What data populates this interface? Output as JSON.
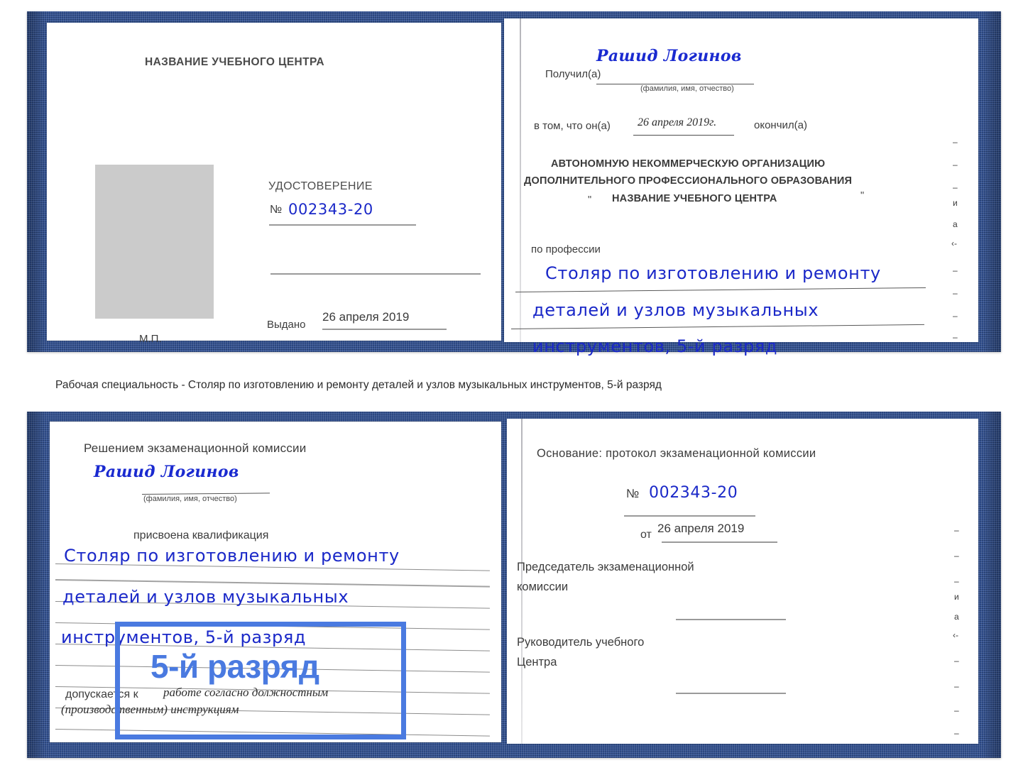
{
  "caption": "Рабочая специальность - Столяр по изготовлению и ремонту деталей и узлов музыкальных инструментов, 5-й разряд",
  "colors": {
    "cover_blue": "#2b4a8b",
    "ink_blue": "#1a2ad0",
    "highlight_blue": "#4a7ae0",
    "photo_gray": "#cbcbcb"
  },
  "certificate_top": {
    "left_page": {
      "title": "НАЗВАНИЕ УЧЕБНОГО ЦЕНТРА",
      "doc_type": "УДОСТОВЕРЕНИЕ",
      "number_prefix": "№",
      "number_value": "002343-20",
      "issued_label": "Выдано",
      "issued_value": "26 апреля 2019",
      "stamp_label": "М.П.",
      "photo_placeholder": "photo-placeholder"
    },
    "right_page": {
      "received_label": "Получил(а)",
      "received_value": "Рашид Логинов",
      "fio_hint": "(фамилия, имя, отчество)",
      "in_that_label": "в том, что он(а)",
      "in_that_date": "26 апреля 2019г.",
      "finished_label": "окончил(а)",
      "org_line1": "АВТОНОМНУЮ НЕКОММЕРЧЕСКУЮ ОРГАНИЗАЦИЮ",
      "org_line2": "ДОПОЛНИТЕЛЬНОГО ПРОФЕССИОНАЛЬНОГО ОБРАЗОВАНИЯ",
      "org_quote_open": "\"",
      "org_line3": "НАЗВАНИЕ УЧЕБНОГО ЦЕНТРА",
      "org_quote_close": "\"",
      "profession_label": "по профессии",
      "profession_line1": "Столяр по изготовлению и ремонту",
      "profession_line2": "деталей и узлов музыкальных",
      "profession_line3": "инструментов, 5-й разряд",
      "edge_fragments": [
        "–",
        "–",
        "–",
        "и",
        "а",
        "‹-",
        "–",
        "–",
        "–",
        "–"
      ]
    }
  },
  "certificate_bottom": {
    "left_page": {
      "title": "Решением экзаменационной комиссии",
      "name_value": "Рашид Логинов",
      "fio_hint": "(фамилия, имя, отчество)",
      "qualification_label": "присвоена квалификация",
      "qualification_line1": "Столяр по изготовлению и ремонту",
      "qualification_line2": "деталей и узлов музыкальных",
      "qualification_line3": "инструментов, 5-й разряд",
      "admitted_label": "допускается к",
      "admitted_value1": "работе согласно должностным",
      "admitted_value2": "(производственным) инструкциям",
      "highlight_text": "5-й разряд"
    },
    "right_page": {
      "basis_label": "Основание: протокол экзаменационной комиссии",
      "number_prefix": "№",
      "number_value": "002343-20",
      "from_label": "от",
      "from_value": "26 апреля 2019",
      "chairman_line1": "Председатель экзаменационной",
      "chairman_line2": "комиссии",
      "head_line1": "Руководитель учебного",
      "head_line2": "Центра",
      "edge_fragments": [
        "–",
        "–",
        "–",
        "и",
        "а",
        "‹-",
        "–",
        "–",
        "–",
        "–"
      ]
    }
  }
}
